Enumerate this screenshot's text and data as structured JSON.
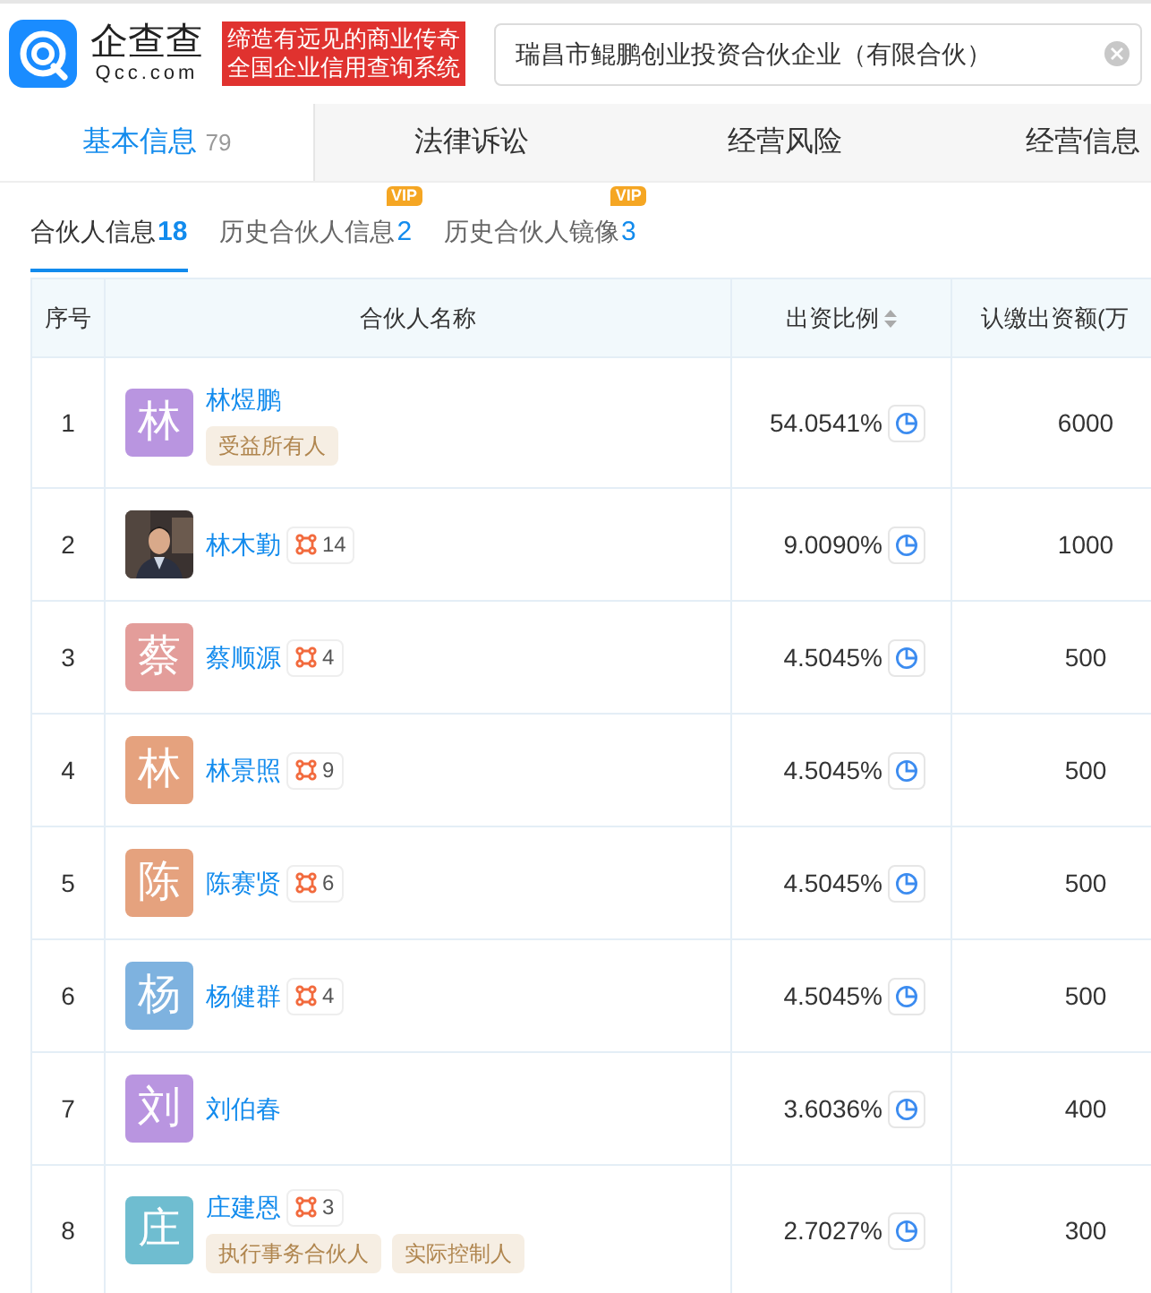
{
  "header": {
    "logo_text": "企查查",
    "logo_domain": "Qcc.com",
    "slogan_lines": [
      "缔造有远见的商业传奇",
      "全国企业信用查询系统"
    ],
    "search": {
      "value": "瑞昌市鲲鹏创业投资合伙企业（有限合伙）"
    }
  },
  "tabs": [
    {
      "label": "基本信息",
      "count": "79",
      "selected": true
    },
    {
      "label": "法律诉讼",
      "selected": false
    },
    {
      "label": "经营风险",
      "selected": false
    },
    {
      "label": "经营信息",
      "selected": false
    }
  ],
  "subtabs": [
    {
      "label": "合伙人信息",
      "count": "18",
      "selected": true
    },
    {
      "label": "历史合伙人信息",
      "count": "2",
      "vip": "VIP",
      "selected": false
    },
    {
      "label": "历史合伙人镜像",
      "count": "3",
      "vip": "VIP",
      "selected": false
    }
  ],
  "table": {
    "columns": [
      "序号",
      "合伙人名称",
      "出资比例",
      "认缴出资额(万"
    ],
    "rows": [
      {
        "index": "1",
        "avatar": {
          "kind": "letter",
          "text": "林",
          "color": "#b995e0"
        },
        "name": "林煜鹏",
        "tags": [
          "受益所有人"
        ],
        "ratio": "54.0541%",
        "amount": "6000"
      },
      {
        "index": "2",
        "name": "林木勤",
        "relations": "14",
        "ratio": "9.0090%",
        "amount": "1000"
      },
      {
        "index": "3",
        "avatar": {
          "kind": "letter",
          "text": "蔡",
          "color": "#e39d9a"
        },
        "name": "蔡顺源",
        "relations": "4",
        "ratio": "4.5045%",
        "amount": "500"
      },
      {
        "index": "4",
        "avatar": {
          "kind": "letter",
          "text": "林",
          "color": "#e5a27e"
        },
        "name": "林景照",
        "relations": "9",
        "ratio": "4.5045%",
        "amount": "500"
      },
      {
        "index": "5",
        "avatar": {
          "kind": "letter",
          "text": "陈",
          "color": "#e5a27e"
        },
        "name": "陈赛贤",
        "relations": "6",
        "ratio": "4.5045%",
        "amount": "500"
      },
      {
        "index": "6",
        "avatar": {
          "kind": "letter",
          "text": "杨",
          "color": "#7eb2df"
        },
        "name": "杨健群",
        "relations": "4",
        "ratio": "4.5045%",
        "amount": "500"
      },
      {
        "index": "7",
        "avatar": {
          "kind": "letter",
          "text": "刘",
          "color": "#b995e0"
        },
        "name": "刘伯春",
        "ratio": "3.6036%",
        "amount": "400"
      },
      {
        "index": "8",
        "avatar": {
          "kind": "letter",
          "text": "庄",
          "color": "#6fbdd0"
        },
        "name": "庄建恩",
        "relations": "3",
        "tags": [
          "执行事务合伙人",
          "实际控制人"
        ],
        "ratio": "2.7027%",
        "amount": "300"
      }
    ]
  }
}
